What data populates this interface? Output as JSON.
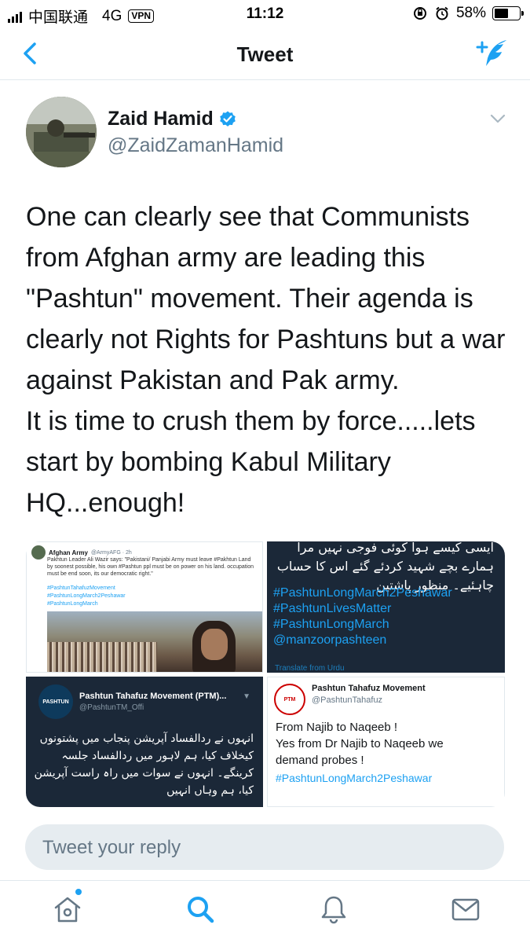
{
  "status_bar": {
    "carrier": "中国联通",
    "network": "4G",
    "vpn": "VPN",
    "time": "11:12",
    "battery": "58%",
    "battery_level": 0.58
  },
  "nav": {
    "title": "Tweet",
    "icons": [
      "back-chevron-icon",
      "compose-tweet-icon"
    ]
  },
  "tweet": {
    "author_name": "Zaid Hamid",
    "author_handle": "@ZaidZamanHamid",
    "verified": true,
    "text": "One can clearly see that Communists\nfrom Afghan army are leading this\n\"Pashtun\" movement. Their agenda is\nclearly not Rights for Pashtuns but a war\nagainst Pakistan and Pak army.\nIt is time to crush them by force.....lets\nstart by bombing Kabul Military\nHQ...enough!"
  },
  "media": {
    "tile1": {
      "name": "Afghan Army",
      "handle": "@ArmyAFG · 2h",
      "body": "Pakhtun Leader Ali Wazir says: \"Pakistani/ Panjabi Army must leave #Pakhtun Land by soonest possible, his own #Pashtun ppl must be on power on his land. occupation must be end soon, its our democratic right.\"",
      "tags": "#PashtunTahafuzMovement\n#PashtunLongMarch2Peshawar\n#PashtunLongMarch"
    },
    "tile2": {
      "urdu": "ایسی کیسے ہوا کوئی فوجی نہیں مرا ہمارے بچے شہید کردئے گئے اس کا حساب چاہئیے۔ منظور پاشتین",
      "tags": "#PashtunLongMarch2Peshawar\n#PashtunLivesMatter\n#PashtunLongMarch\n@manzoorpashteen",
      "translate": "Translate from Urdu"
    },
    "tile3": {
      "avatar_text": "PASHTUN",
      "name": "Pashtun Tahafuz Movement (PTM)...",
      "handle": "@PashtunTM_Offi",
      "urdu": "انہوں نے ردالفساد آپریشن پنجاب میں پشتونوں کیخلاف کیا، ہم لاہور میں ردالفساد جلسہ کرینگے۔ انہوں نے سوات میں راہ راست آپریشن کیا، ہم وہاں انہیں"
    },
    "tile4": {
      "avatar_text": "PTM",
      "name": "Pashtun Tahafuz Movement",
      "handle": "@PashtunTahafuz",
      "body": "From Najib to Naqeeb !\nYes from Dr Najib to Naqeeb we\ndemand probes !",
      "tag": "#PashtunLongMarch2Peshawar"
    }
  },
  "reply": {
    "placeholder": "Tweet your reply"
  },
  "tabbar": {
    "items": [
      "home-icon",
      "search-icon",
      "notifications-icon",
      "messages-icon"
    ],
    "active": "search-icon"
  },
  "colors": {
    "accent": "#1da1f2",
    "text": "#14171a",
    "secondary": "#657786",
    "dark_tile": "#1b2838"
  }
}
